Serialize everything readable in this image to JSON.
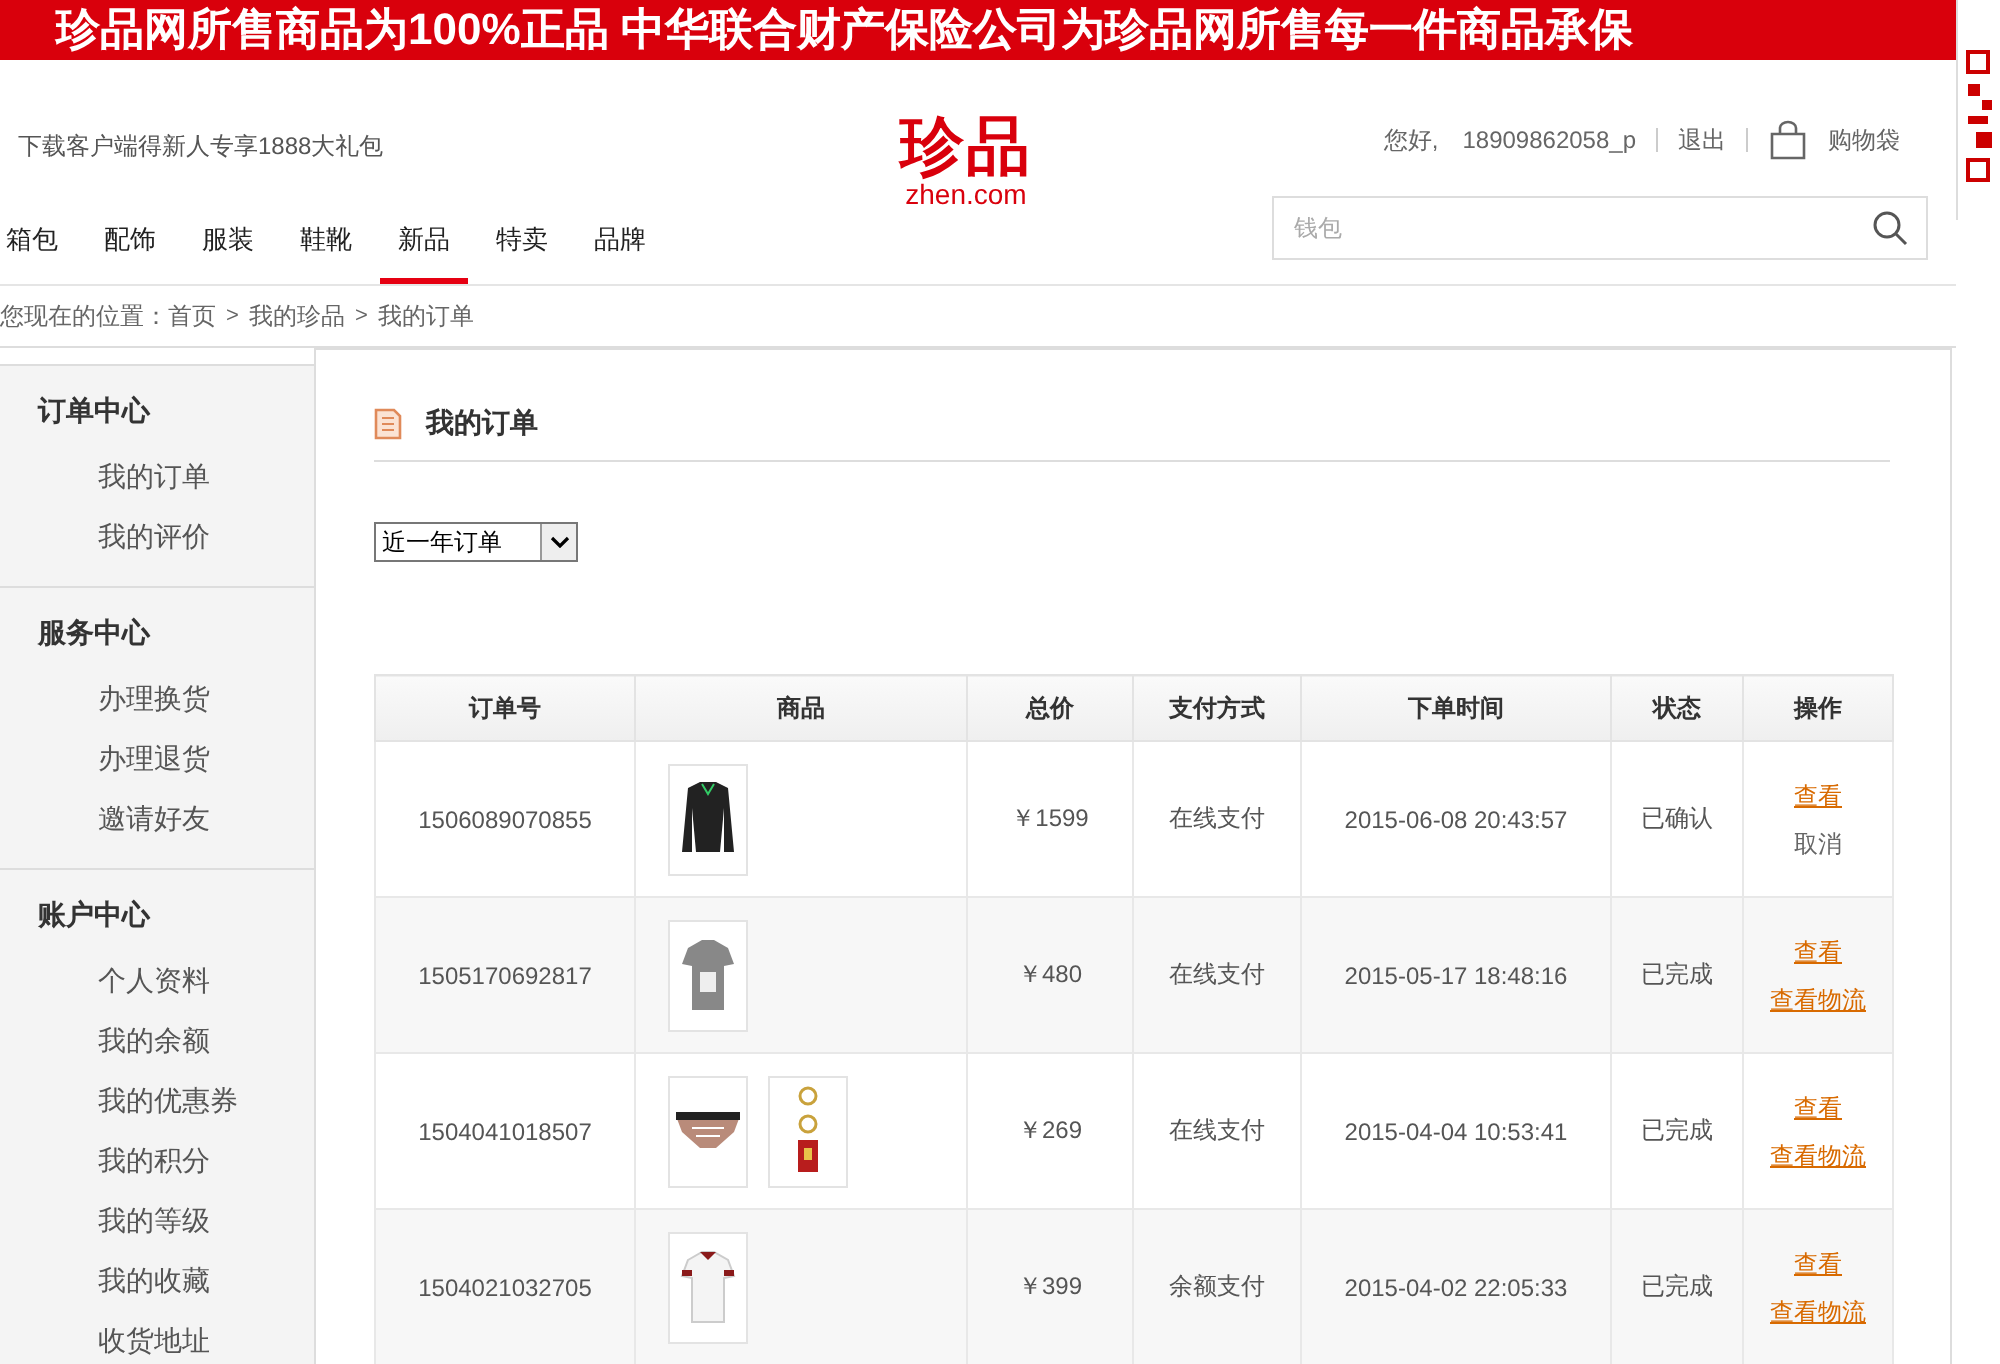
{
  "banner": {
    "text": "珍品网所售商品为100%正品  中华联合财产保险公司为珍品网所售每一件商品承保"
  },
  "header": {
    "promo": "下载客户端得新人专享1888大礼包",
    "logo": {
      "name": "珍品",
      "domain": "zhen.com"
    },
    "greeting": "您好,",
    "username": "18909862058_p",
    "logout": "退出",
    "cart": "购物袋"
  },
  "nav": [
    {
      "label": "箱包",
      "selected": false
    },
    {
      "label": "配饰",
      "selected": false
    },
    {
      "label": "服装",
      "selected": false
    },
    {
      "label": "鞋靴",
      "selected": false
    },
    {
      "label": "新品",
      "selected": true
    },
    {
      "label": "特卖",
      "selected": false
    },
    {
      "label": "品牌",
      "selected": false
    }
  ],
  "search": {
    "placeholder": "钱包"
  },
  "breadcrumb": {
    "label": "您现在的位置：",
    "separator": ">",
    "items": [
      "首页",
      "我的珍品",
      "我的订单"
    ]
  },
  "sidebar": [
    {
      "title": "订单中心",
      "items": [
        "我的订单",
        "我的评价"
      ]
    },
    {
      "title": "服务中心",
      "items": [
        "办理换货",
        "办理退货",
        "邀请好友"
      ]
    },
    {
      "title": "账户中心",
      "items": [
        "个人资料",
        "我的余额",
        "我的优惠券",
        "我的积分",
        "我的等级",
        "我的收藏",
        "收货地址"
      ]
    }
  ],
  "main": {
    "title": "我的订单",
    "filter": "近一年订单",
    "table": {
      "columns": [
        "订单号",
        "商品",
        "总价",
        "支付方式",
        "下单时间",
        "状态",
        "操作"
      ],
      "rows": [
        {
          "order_no": "1506089070855",
          "products": [
            {
              "kind": "jacket"
            }
          ],
          "price": "￥1599",
          "payment": "在线支付",
          "time": "2015-06-08 20:43:57",
          "status": "已确认",
          "actions": [
            {
              "kind": "link",
              "label": "查看"
            },
            {
              "kind": "plain",
              "label": "取消"
            }
          ]
        },
        {
          "order_no": "1505170692817",
          "products": [
            {
              "kind": "tshirt"
            }
          ],
          "price": "￥480",
          "payment": "在线支付",
          "time": "2015-05-17 18:48:16",
          "status": "已完成",
          "actions": [
            {
              "kind": "link",
              "label": "查看"
            },
            {
              "kind": "link",
              "label": "查看物流"
            }
          ]
        },
        {
          "order_no": "1504041018507",
          "products": [
            {
              "kind": "bag"
            },
            {
              "kind": "keychain"
            }
          ],
          "price": "￥269",
          "payment": "在线支付",
          "time": "2015-04-04 10:53:41",
          "status": "已完成",
          "actions": [
            {
              "kind": "link",
              "label": "查看"
            },
            {
              "kind": "link",
              "label": "查看物流"
            }
          ]
        },
        {
          "order_no": "1504021032705",
          "products": [
            {
              "kind": "polo"
            }
          ],
          "price": "￥399",
          "payment": "余额支付",
          "time": "2015-04-02 22:05:33",
          "status": "已完成",
          "actions": [
            {
              "kind": "link",
              "label": "查看"
            },
            {
              "kind": "link",
              "label": "查看物流"
            }
          ]
        }
      ]
    }
  }
}
